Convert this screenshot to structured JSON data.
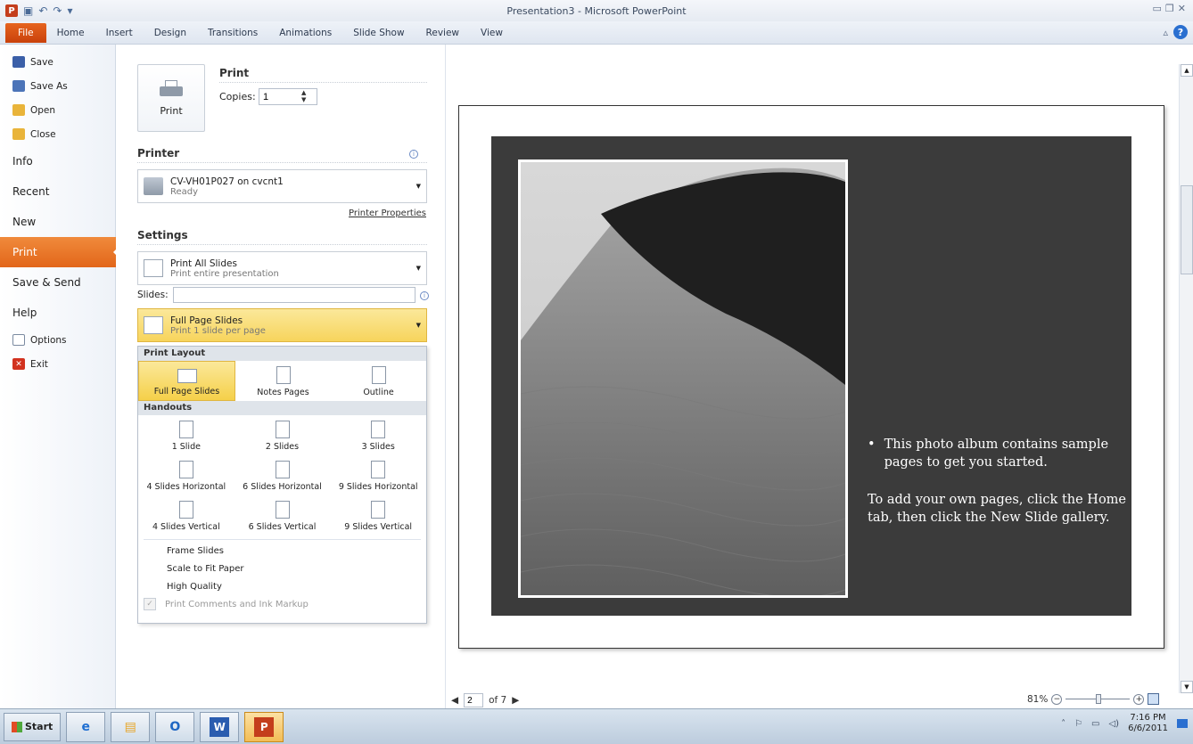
{
  "window": {
    "title": "Presentation3 - Microsoft PowerPoint"
  },
  "ribbon_tabs": [
    {
      "label": "File"
    },
    {
      "label": "Home"
    },
    {
      "label": "Insert"
    },
    {
      "label": "Design"
    },
    {
      "label": "Transitions"
    },
    {
      "label": "Animations"
    },
    {
      "label": "Slide Show"
    },
    {
      "label": "Review"
    },
    {
      "label": "View"
    }
  ],
  "nav": {
    "small_items": [
      {
        "label": "Save",
        "icon": "save-icon"
      },
      {
        "label": "Save As",
        "icon": "save-as-icon"
      },
      {
        "label": "Open",
        "icon": "open-folder-icon"
      },
      {
        "label": "Close",
        "icon": "close-folder-icon"
      }
    ],
    "info": "Info",
    "recent": "Recent",
    "new": "New",
    "print": "Print",
    "save_send": "Save & Send",
    "help": "Help",
    "options": "Options",
    "exit": "Exit"
  },
  "print": {
    "title": "Print",
    "button_label": "Print",
    "copies_label": "Copies:",
    "copies_value": "1"
  },
  "printer": {
    "section_title": "Printer",
    "name": "CV-VH01P027 on cvcnt1",
    "status": "Ready",
    "properties_link": "Printer Properties"
  },
  "settings": {
    "section_title": "Settings",
    "range_main": "Print All Slides",
    "range_sub": "Print entire presentation",
    "slides_label": "Slides:",
    "layout_main": "Full Page Slides",
    "layout_sub": "Print 1 slide per page"
  },
  "layout_panel": {
    "print_layout_header": "Print Layout",
    "print_layout_items": [
      "Full Page Slides",
      "Notes Pages",
      "Outline"
    ],
    "handouts_header": "Handouts",
    "handouts_row1": [
      "1 Slide",
      "2 Slides",
      "3 Slides"
    ],
    "handouts_row2": [
      "4 Slides Horizontal",
      "6 Slides Horizontal",
      "9 Slides Horizontal"
    ],
    "handouts_row3": [
      "4 Slides Vertical",
      "6 Slides Vertical",
      "9 Slides Vertical"
    ],
    "options": [
      "Frame Slides",
      "Scale to Fit Paper",
      "High Quality"
    ],
    "disabled_option": "Print Comments and Ink Markup"
  },
  "slide": {
    "bullet": "This photo album contains sample pages to get you started.",
    "body": "To add your own pages, click the Home tab, then click the New Slide gallery."
  },
  "pager": {
    "current": "2",
    "of_text": "of 7"
  },
  "zoom": {
    "level": "81%"
  },
  "taskbar": {
    "start_label": "Start",
    "time": "7:16 PM",
    "date": "6/6/2011"
  },
  "colors": {
    "file_tab": "#d5531a",
    "highlight": "#f7d45c",
    "slide_bg": "#3b3b3b"
  }
}
